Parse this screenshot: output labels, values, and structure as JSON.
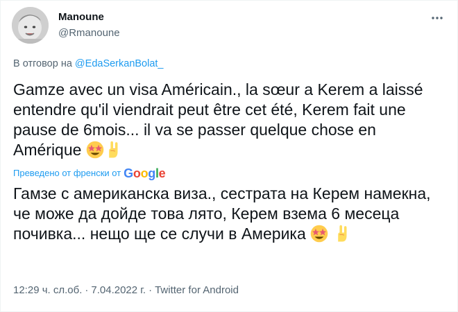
{
  "author": {
    "display_name": "Manoune",
    "handle": "@Rmanoune",
    "avatar_icon": "baby-photo-avatar"
  },
  "more_icon": "more-options-icon",
  "reply": {
    "prefix": "В отговор на",
    "mention": "@EdaSerkanBolat_"
  },
  "tweet": {
    "text": "Gamze avec un visa Américain., la sœur a Kerem a laissé entendre qu'il viendrait peut être cet été, Kerem fait une pause de 6mois... il va se passer quelque chose en Amérique",
    "emojis": [
      "star-struck-emoji",
      "sign-of-the-horns-emoji"
    ]
  },
  "translation": {
    "label": "Преведено от френски от",
    "provider": "Google",
    "text": "Гамзе с американска виза., сестрата на Керем намекна, че може да дойде това лято, Керем взема 6 месеца почивка... нещо ще се случи в Америка"
  },
  "meta": {
    "time": "12:29 ч. сл.об.",
    "date": "7.04.2022 г.",
    "source": "Twitter for Android",
    "separator": "·"
  },
  "colors": {
    "link": "#1d9bf0",
    "text": "#0f1419",
    "secondary": "#536471"
  }
}
